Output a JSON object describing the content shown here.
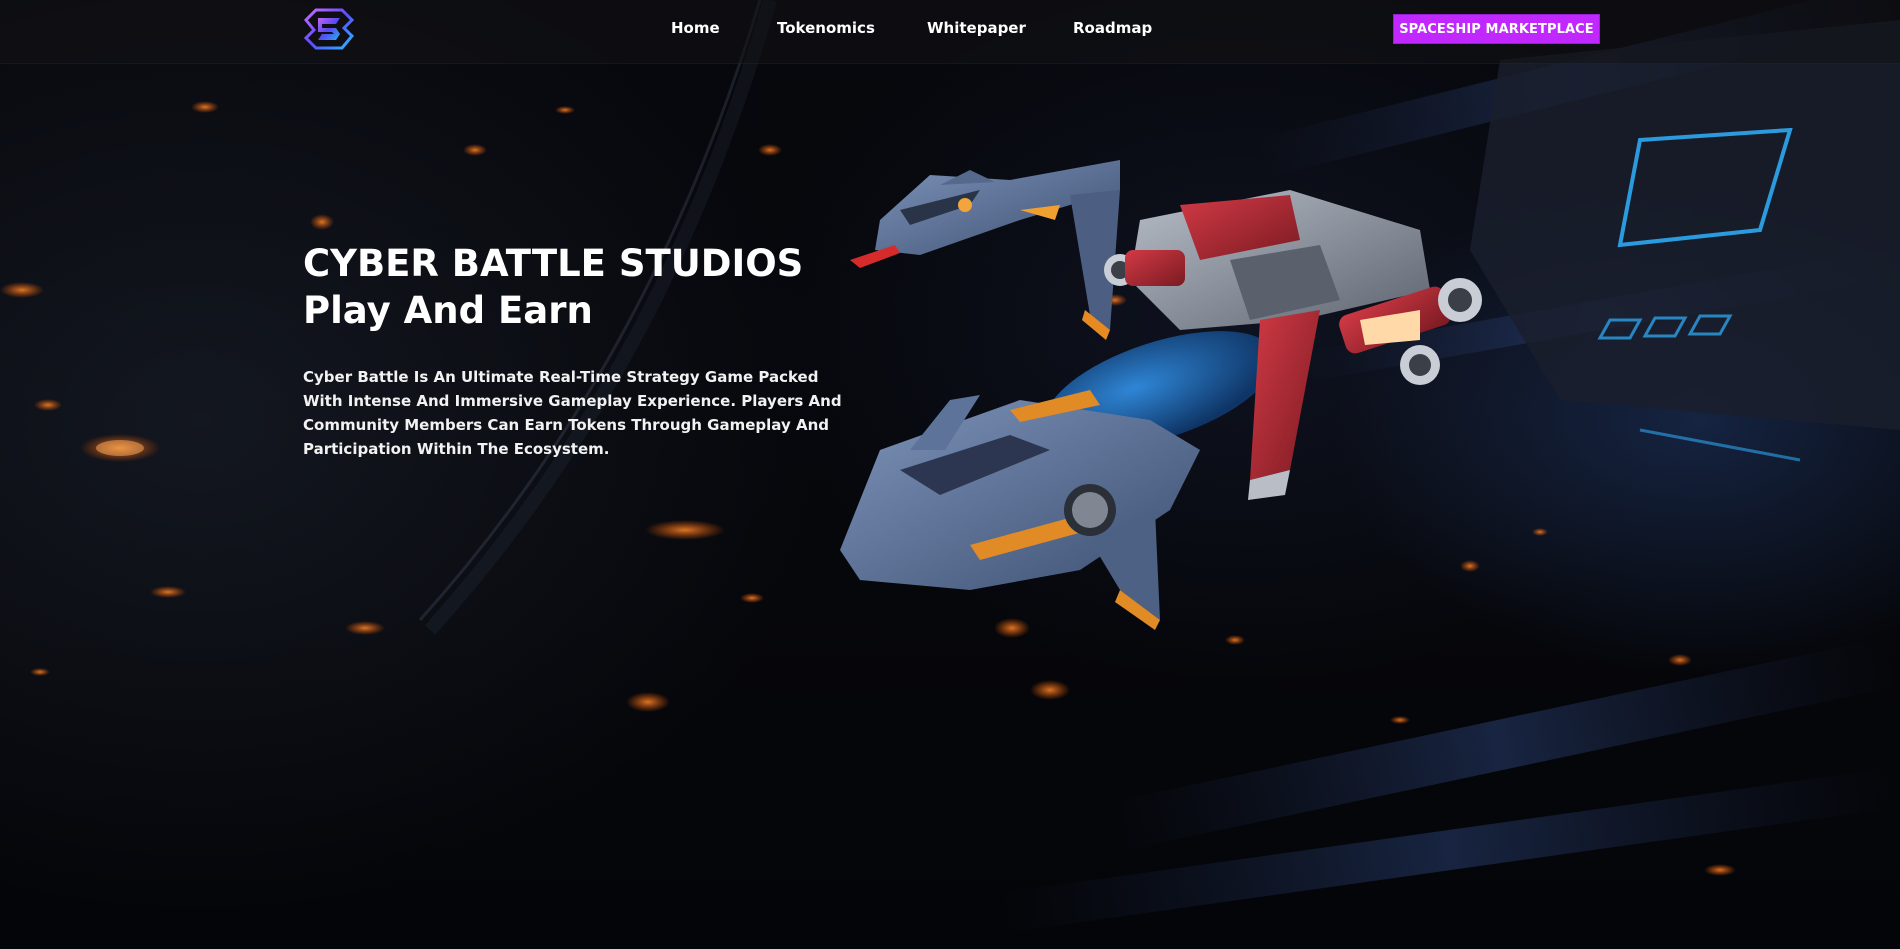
{
  "header": {
    "logo_icon": "cyber-battle-logo-icon",
    "nav": [
      "Home",
      "Tokenomics",
      "Whitepaper",
      "Roadmap"
    ],
    "cta_label": "SPACESHIP MARKETPLACE"
  },
  "hero": {
    "title_line1": "CYBER BATTLE STUDIOS",
    "title_line2": "Play And Earn",
    "description": "Cyber Battle Is An Ultimate Real-Time Strategy Game Packed With Intense And Immersive Gameplay Experience. Players And Community Members Can Earn Tokens Through Gameplay And Participation Within The Ecosystem.",
    "artwork": "spaceships-artwork"
  },
  "colors": {
    "accent": "#c128ff",
    "background": "#05060a",
    "text": "#ffffff"
  }
}
